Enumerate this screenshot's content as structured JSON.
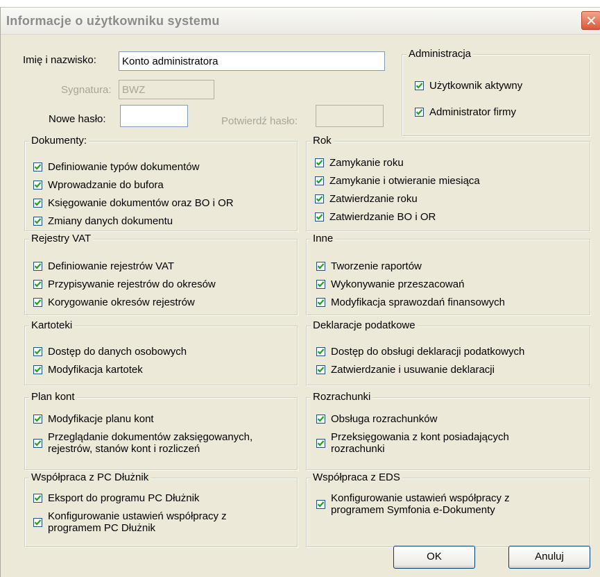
{
  "window": {
    "title": "Informacje o użytkowniku systemu",
    "close_glyph": "✕"
  },
  "form": {
    "name_label": "Imię i nazwisko:",
    "name_value": "Konto administratora",
    "signature_label": "Sygnatura:",
    "signature_value": "BWZ",
    "new_password_label": "Nowe hasło:",
    "new_password_value": "",
    "confirm_password_label": "Potwierdź hasło:",
    "confirm_password_value": ""
  },
  "groups": {
    "administracja": {
      "title": "Administracja",
      "items": [
        {
          "label": "Użytkownik aktywny",
          "checked": true
        },
        {
          "label": "Administrator firmy",
          "checked": true
        }
      ]
    },
    "dokumenty": {
      "title": "Dokumenty:",
      "items": [
        {
          "label": "Definiowanie typów dokumentów",
          "checked": true
        },
        {
          "label": "Wprowadzanie do bufora",
          "checked": true
        },
        {
          "label": "Księgowanie dokumentów oraz BO i OR",
          "checked": true
        },
        {
          "label": "Zmiany danych dokumentu",
          "checked": true
        }
      ]
    },
    "rok": {
      "title": "Rok",
      "items": [
        {
          "label": "Zamykanie roku",
          "checked": true
        },
        {
          "label": "Zamykanie i otwieranie miesiąca",
          "checked": true
        },
        {
          "label": "Zatwierdzanie roku",
          "checked": true
        },
        {
          "label": "Zatwierdzanie BO i OR",
          "checked": true
        }
      ]
    },
    "rejestry_vat": {
      "title": "Rejestry VAT",
      "items": [
        {
          "label": "Definiowanie rejestrów VAT",
          "checked": true
        },
        {
          "label": "Przypisywanie rejestrów do okresów",
          "checked": true
        },
        {
          "label": "Korygowanie okresów rejestrów",
          "checked": true
        }
      ]
    },
    "inne": {
      "title": "Inne",
      "items": [
        {
          "label": "Tworzenie raportów",
          "checked": true
        },
        {
          "label": "Wykonywanie przeszacowań",
          "checked": true
        },
        {
          "label": "Modyfikacja sprawozdań finansowych",
          "checked": true
        }
      ]
    },
    "kartoteki": {
      "title": "Kartoteki",
      "items": [
        {
          "label": "Dostęp do danych osobowych",
          "checked": true
        },
        {
          "label": "Modyfikacja kartotek",
          "checked": true
        }
      ]
    },
    "deklaracje": {
      "title": "Deklaracje podatkowe",
      "items": [
        {
          "label": "Dostęp do obsługi deklaracji podatkowych",
          "checked": true
        },
        {
          "label": "Zatwierdzanie i usuwanie deklaracji",
          "checked": true
        }
      ]
    },
    "plan_kont": {
      "title": "Plan kont",
      "items": [
        {
          "label": "Modyfikacje planu kont",
          "checked": true
        },
        {
          "label": "Przeglądanie dokumentów zaksięgowanych,",
          "label2": "rejestrów, stanów kont i rozliczeń",
          "checked": true
        }
      ]
    },
    "rozrachunki": {
      "title": "Rozrachunki",
      "items": [
        {
          "label": "Obsługa rozrachunków",
          "checked": true
        },
        {
          "label": "Przeksięgowania z kont posiadających",
          "label2": "rozrachunki",
          "checked": true
        }
      ]
    },
    "pc_dluznik": {
      "title": "Współpraca z PC Dłużnik",
      "items": [
        {
          "label": "Eksport do programu PC Dłużnik",
          "checked": true
        },
        {
          "label": "Konfigurowanie ustawień współpracy z",
          "label2": "programem PC Dłużnik",
          "checked": true
        }
      ]
    },
    "eds": {
      "title": "Współpraca z EDS",
      "items": [
        {
          "label": "Konfigurowanie ustawień współpracy z",
          "label2": "programem Symfonia e-Dokumenty",
          "checked": true
        }
      ]
    }
  },
  "buttons": {
    "ok": "OK",
    "cancel": "Anuluj"
  }
}
